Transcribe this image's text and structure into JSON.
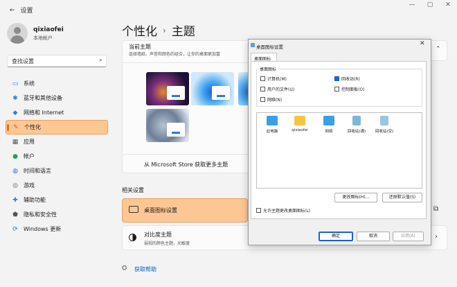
{
  "window": {
    "back": "←",
    "title": "设置",
    "min": "—",
    "max": "▢",
    "close": "✕"
  },
  "user": {
    "name": "qixiaofei",
    "account": "本地帐户"
  },
  "search": {
    "placeholder": "查找设置"
  },
  "nav": [
    {
      "label": "系统",
      "icon": "monitor-icon",
      "glyph": "▭",
      "color": "#2a7bd6"
    },
    {
      "label": "蓝牙和其他设备",
      "icon": "bluetooth-icon",
      "glyph": "✱",
      "color": "#2a7bd6"
    },
    {
      "label": "网络和 Internet",
      "icon": "wifi-icon",
      "glyph": "◆",
      "color": "#2a7bd6"
    },
    {
      "label": "个性化",
      "icon": "pen-icon",
      "glyph": "✎",
      "color": "#c26a1a",
      "active": true
    },
    {
      "label": "应用",
      "icon": "apps-icon",
      "glyph": "▦",
      "color": "#555555"
    },
    {
      "label": "帐户",
      "icon": "person-icon",
      "glyph": "●",
      "color": "#2a9d63"
    },
    {
      "label": "时间和语言",
      "icon": "globe-icon",
      "glyph": "◍",
      "color": "#2a7bd6"
    },
    {
      "label": "游戏",
      "icon": "gamepad-icon",
      "glyph": "◎",
      "color": "#555555"
    },
    {
      "label": "辅助功能",
      "icon": "accessibility-icon",
      "glyph": "✚",
      "color": "#2a7bd6"
    },
    {
      "label": "隐私和安全性",
      "icon": "shield-icon",
      "glyph": "⬟",
      "color": "#555555"
    },
    {
      "label": "Windows 更新",
      "icon": "update-icon",
      "glyph": "⟳",
      "color": "#2a7bd6"
    }
  ],
  "breadcrumb": {
    "parent": "个性化",
    "separator": "›",
    "current": "主题"
  },
  "theme": {
    "title": "当前主题",
    "subtitle": "选择墙纸、声音和颜色的组合，让你的桌面更加富"
  },
  "store": {
    "label": "从 Microsoft Store 获取更多主题"
  },
  "related": {
    "heading": "相关设置",
    "desktop_icons": "桌面图标设置",
    "contrast_title": "对比度主题",
    "contrast_sub": "弱视的颜色主题，光敏度"
  },
  "help": {
    "label": "获取帮助"
  },
  "dialog": {
    "title": "桌面图标设置",
    "close": "✕",
    "tab": "桌面图标",
    "group_label": "桌面图标",
    "checkboxes": [
      {
        "label": "计算机(M)",
        "checked": false
      },
      {
        "label": "回收站(R)",
        "checked": true
      },
      {
        "label": "用户的文件(U)",
        "checked": false
      },
      {
        "label": "控制面板(O)",
        "checked": false
      },
      {
        "label": "网络(N)",
        "checked": false
      }
    ],
    "icons": [
      {
        "label": "此电脑",
        "icon": "computer-icon",
        "color": "#3aa0e6"
      },
      {
        "label": "qixiaofei",
        "icon": "folder-icon",
        "color": "#f5c542"
      },
      {
        "label": "网络",
        "icon": "network-icon",
        "color": "#3aa0e6"
      },
      {
        "label": "回收站(满)",
        "icon": "recycle-full-icon",
        "color": "#7fb6d9"
      },
      {
        "label": "回收站(空)",
        "icon": "recycle-empty-icon",
        "color": "#9cc6e0"
      }
    ],
    "change_icon": "更改图标(H)...",
    "restore_default": "还原默认值(S)",
    "allow_themes": "允许主题更改桌面图标(L)",
    "ok": "确定",
    "cancel": "取消",
    "apply": "应用(A)"
  }
}
